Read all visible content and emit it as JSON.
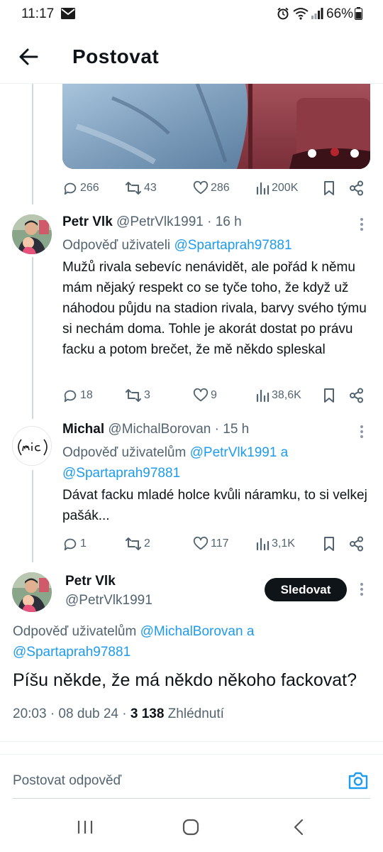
{
  "status": {
    "time": "11:17",
    "battery": "66%"
  },
  "header": {
    "title": "Postovat"
  },
  "parent_actions": {
    "replies": "266",
    "reposts": "43",
    "likes": "286",
    "views": "200K"
  },
  "tweets": [
    {
      "name": "Petr Vlk",
      "handle": "@PetrVlk1991",
      "time": "· 16 h",
      "reply_prefix": "Odpověď uživateli ",
      "reply_to_1": "@Spartaprah97881",
      "text": "Mužů rivala sebevíc nenávidět, ale pořád k němu mám nějaký respekt co se tyče toho, že když už náhodou půjdu na stadion rivala, barvy svého týmu si nechám doma. Tohle je akorát dostat po právu facku a potom brečet, že mě někdo spleskal",
      "replies": "18",
      "reposts": "3",
      "likes": "9",
      "views": "38,6K"
    },
    {
      "name": "Michal",
      "handle": "@MichalBorovan",
      "time": "· 15 h",
      "reply_prefix": "Odpověď uživatelům ",
      "reply_to_1": "@PetrVlk1991",
      "reply_joiner": " a",
      "reply_to_2": "@Spartaprah97881",
      "text": "Dávat facku mladé holce kvůli náramku, to si velkej pašák...",
      "replies": "1",
      "reposts": "2",
      "likes": "117",
      "views": "3,1K"
    }
  ],
  "focus": {
    "name": "Petr Vlk",
    "handle": "@PetrVlk1991",
    "follow_label": "Sledovat",
    "reply_prefix": "Odpověď uživatelům ",
    "reply_to_1": "@MichalBorovan",
    "reply_joiner": " a",
    "reply_to_2": "@Spartaprah97881",
    "text": "Píšu někde, že má někdo někoho fackovat?",
    "timestamp": "20:03 · 08 dub 24 · ",
    "views_count": "3 138",
    "views_label": " Zhlédnutí"
  },
  "composer": {
    "placeholder": "Postovat odpověď"
  },
  "colors": {
    "accent": "#1d9bf0",
    "text": "#0f1419",
    "muted": "#536471"
  }
}
